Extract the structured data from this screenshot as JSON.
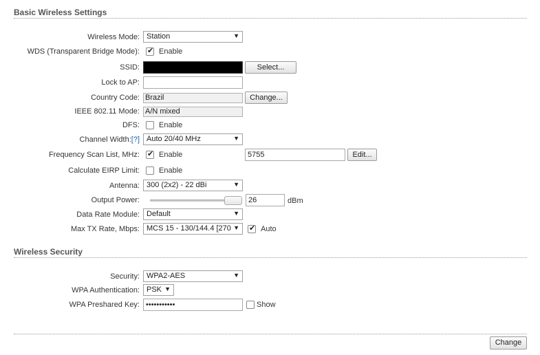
{
  "basic": {
    "title": "Basic Wireless Settings",
    "wireless_mode_label": "Wireless Mode:",
    "wireless_mode_value": "Station",
    "wds_label": "WDS (Transparent Bridge Mode):",
    "wds_enable": "Enable",
    "ssid_label": "SSID:",
    "ssid_select_button": "Select...",
    "lock_ap_label": "Lock to AP:",
    "lock_ap_value": "",
    "country_label": "Country Code:",
    "country_value": "Brazil",
    "country_change_button": "Change...",
    "ieee_label": "IEEE 802.11 Mode:",
    "ieee_value": "A/N mixed",
    "dfs_label": "DFS:",
    "dfs_enable": "Enable",
    "channel_width_label": "Channel Width:",
    "channel_width_help": "[?]",
    "channel_width_value": "Auto 20/40 MHz",
    "freq_scan_label": "Frequency Scan List, MHz:",
    "freq_scan_enable": "Enable",
    "freq_scan_value": "5755",
    "freq_edit_button": "Edit...",
    "eirp_label": "Calculate EIRP Limit:",
    "eirp_enable": "Enable",
    "antenna_label": "Antenna:",
    "antenna_value": "300 (2x2) - 22 dBi",
    "output_power_label": "Output Power:",
    "output_power_value": "26",
    "output_power_unit": "dBm",
    "data_rate_label": "Data Rate Module:",
    "data_rate_value": "Default",
    "max_tx_label": "Max TX Rate, Mbps:",
    "max_tx_value": "MCS 15 - 130/144.4 [270",
    "max_tx_auto": "Auto"
  },
  "security": {
    "title": "Wireless Security",
    "security_label": "Security:",
    "security_value": "WPA2-AES",
    "wpa_auth_label": "WPA Authentication:",
    "wpa_auth_value": "PSK",
    "wpa_key_label": "WPA Preshared Key:",
    "wpa_key_value": "•••••••••••",
    "show_label": "Show"
  },
  "footer": {
    "change_button": "Change"
  },
  "icons": {
    "dropdown": "▼"
  }
}
